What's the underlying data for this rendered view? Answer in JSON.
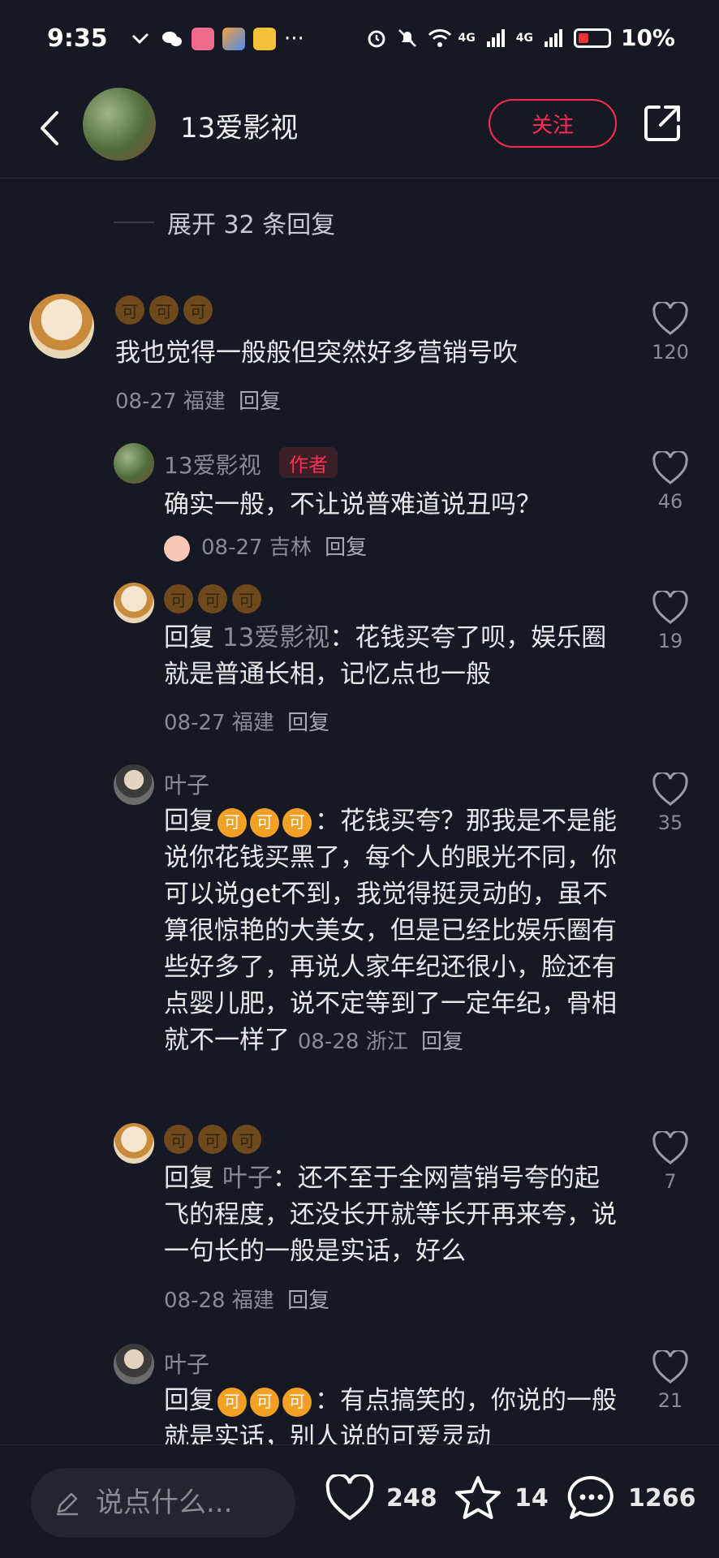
{
  "status_bar": {
    "time": "9:35",
    "battery": "10%",
    "more": "···",
    "net_labels": [
      "4G",
      "4G"
    ]
  },
  "header": {
    "title": "13爱影视",
    "follow_label": "关注"
  },
  "expand_replies": "展开 32 条回复",
  "comments": [
    {
      "name_glyph": "可",
      "text": "我也觉得一般般但突然好多营销号吹",
      "date": "08-27",
      "location": "福建",
      "reply_label": "回复",
      "likes": "120"
    },
    {
      "name": "13爱影视",
      "author_tag": "作者",
      "text": "确实一般，不让说普难道说丑吗？",
      "date": "08-27",
      "location": "吉林",
      "reply_label": "回复",
      "likes": "46"
    },
    {
      "name_glyph": "可",
      "reply_prefix": "回复",
      "reply_target": "13爱影视",
      "text": "：花钱买夸了呗，娱乐圈就是普通长相，记忆点也一般",
      "date": "08-27",
      "location": "福建",
      "reply_label": "回复",
      "likes": "19"
    },
    {
      "name": "叶子",
      "reply_prefix": "回复",
      "text": "：花钱买夸？那我是不是能说你花钱买黑了，每个人的眼光不同，你可以说get不到，我觉得挺灵动的，虽不算很惊艳的大美女，但是已经比娱乐圈有些好多了，再说人家年纪还很小，脸还有点婴儿肥，说不定等到了一定年纪，骨相就不一样了",
      "date": "08-28",
      "location": "浙江",
      "reply_label": "回复",
      "likes": "35"
    },
    {
      "name_glyph": "可",
      "reply_prefix": "回复",
      "reply_target": "叶子",
      "text": "：还不至于全网营销号夸的起飞的程度，还没长开就等长开再来夸，说一句长的一般是实话，好么",
      "date": "08-28",
      "location": "福建",
      "reply_label": "回复",
      "likes": "7"
    },
    {
      "name": "叶子",
      "reply_prefix": "回复",
      "text": "：有点搞笑的，你说的一般就是实话，别人说的可爱灵动",
      "likes": "21"
    }
  ],
  "bottom_bar": {
    "input_placeholder": "说点什么...",
    "like_count": "248",
    "favorite_count": "14",
    "comment_count": "1266"
  }
}
